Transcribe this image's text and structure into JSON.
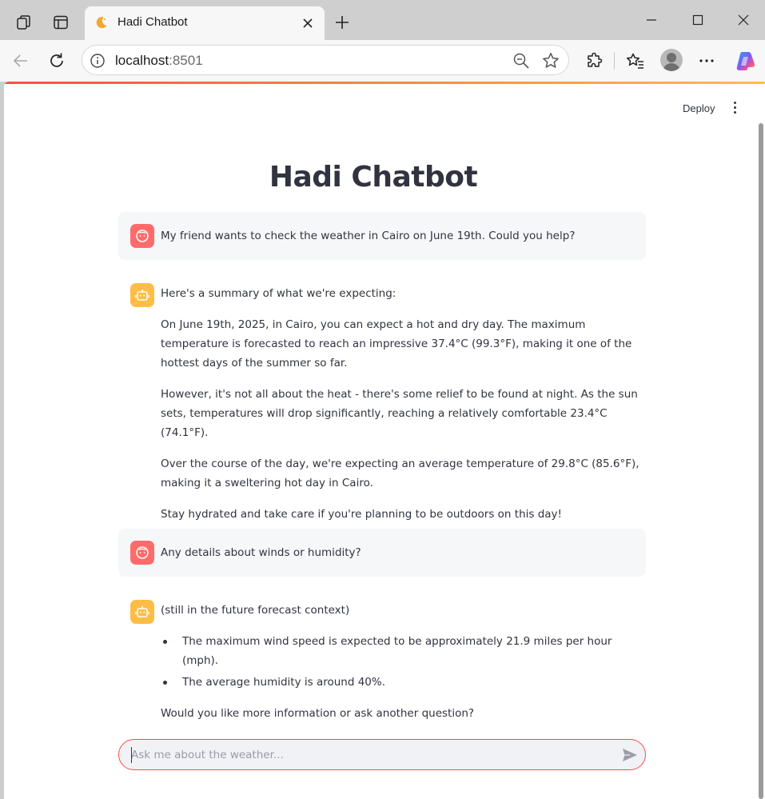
{
  "browser": {
    "tab_title": "Hadi Chatbot",
    "address": {
      "host": "localhost",
      "port": ":8501"
    }
  },
  "app": {
    "deploy_label": "Deploy",
    "title": "Hadi Chatbot"
  },
  "messages": {
    "user1": "My friend wants to check the weather in Cairo on June 19th. Could you help?",
    "bot1": {
      "p1": "Here's a summary of what we're expecting:",
      "p2": "On June 19th, 2025, in Cairo, you can expect a hot and dry day. The maximum temperature is forecasted to reach an impressive 37.4°C (99.3°F), making it one of the hottest days of the summer so far.",
      "p3": "However, it's not all about the heat - there's some relief to be found at night. As the sun sets, temperatures will drop significantly, reaching a relatively comfortable 23.4°C (74.1°F).",
      "p4": "Over the course of the day, we're expecting an average temperature of 29.8°C (85.6°F), making it a sweltering hot day in Cairo.",
      "p5": "Stay hydrated and take care if you're planning to be outdoors on this day!"
    },
    "user2": "Any details about winds or humidity?",
    "bot2": {
      "intro": "(still in the future forecast context)",
      "bullets": [
        "The maximum wind speed is expected to be approximately 21.9 miles per hour (mph).",
        "The average humidity is around 40%."
      ],
      "outro": "Would you like more information or ask another question?"
    }
  },
  "chat_input": {
    "placeholder": "Ask me about the weather..."
  },
  "colors": {
    "user_avatar": "#ff6b6b",
    "bot_avatar": "#ffbd45",
    "input_border": "#ff4b4b",
    "text": "#31333f"
  },
  "icons": [
    "workspaces-icon",
    "tab-actions-icon",
    "moon-favicon-icon",
    "close-icon",
    "plus-icon",
    "minimize-icon",
    "maximize-icon",
    "window-close-icon",
    "back-arrow-icon",
    "refresh-icon",
    "info-icon",
    "zoom-out-icon",
    "star-icon",
    "extensions-icon",
    "favorites-icon",
    "profile-icon",
    "more-icon",
    "copilot-icon",
    "kebab-menu-icon",
    "user-face-icon",
    "bot-icon",
    "send-icon"
  ]
}
